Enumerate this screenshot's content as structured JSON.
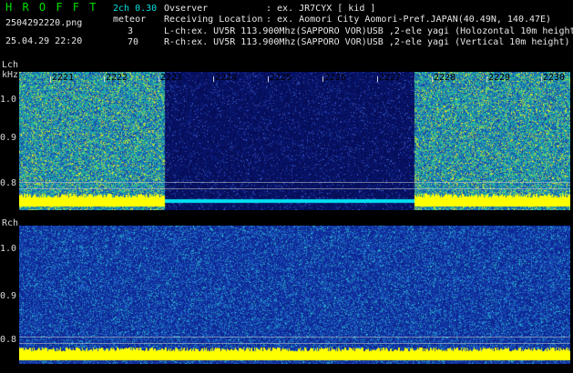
{
  "header": {
    "app_title": "H R O F F T",
    "filename": "2504292220.png",
    "datetime": "25.04.29 22:20",
    "mode": "2ch 0.30",
    "meteor_label": "meteor",
    "meteor_l": "3",
    "meteor_r": "70",
    "observer_label": "Ovserver",
    "observer_value": ": ex. JR7CYX [ kid ]",
    "location_label": "Receiving Location",
    "location_value": ": ex. Aomori City Aomori-Pref.JAPAN(40.49N, 140.47E)",
    "lch_desc": "L-ch:ex. UV5R 113.900Mhz(SAPPORO VOR)USB ,2-ele yagi (Holozontal 10m height)",
    "rch_desc": "R-ch:ex. UV5R 113.900Mhz(SAPPORO VOR)USB ,2-ele yagi (Vertical 10m height)"
  },
  "lch": {
    "label": "Lch",
    "unit": "kHz",
    "yticks": [
      "1.0",
      "0.9",
      "0.8"
    ]
  },
  "rch": {
    "label": "Rch",
    "yticks": [
      "1.0",
      "0.9",
      "0.8"
    ]
  },
  "time_labels": [
    "2221",
    "2222",
    "2223",
    "2224",
    "2225",
    "2226",
    "2227",
    "2228",
    "2229",
    "2230"
  ],
  "colors": {
    "background": "#000000",
    "header_green": "#00e000",
    "header_cyan": "#00e0e0",
    "active_noise": "#2aa8c8",
    "quiet_band": "#0a1a6a",
    "carrier_yellow": "#ffff00",
    "carrier_cyan": "#00e0f0"
  }
}
